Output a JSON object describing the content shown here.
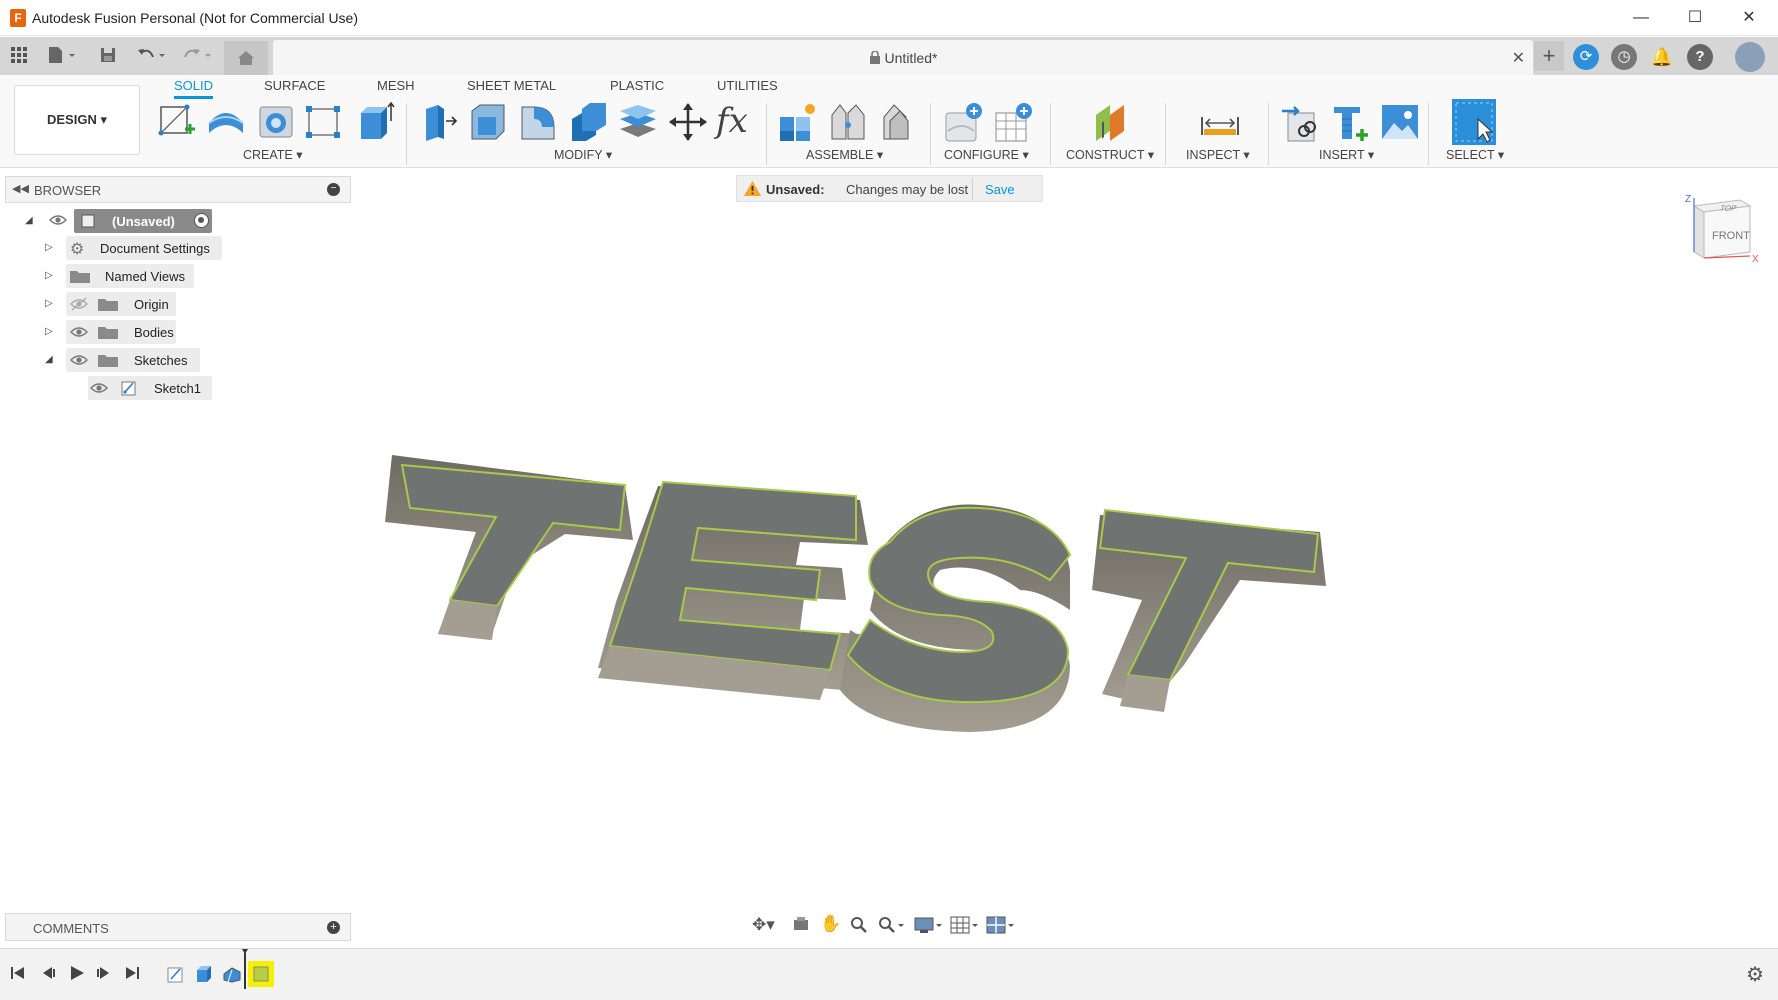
{
  "window": {
    "title": "Autodesk Fusion Personal (Not for Commercial Use)",
    "logo_letter": "F",
    "minimize": "—",
    "maximize": "☐",
    "close": "✕"
  },
  "document": {
    "title": "Untitled*",
    "close": "✕"
  },
  "workspace": {
    "label": "DESIGN ▾"
  },
  "tabs": [
    {
      "label": "SOLID",
      "active": true
    },
    {
      "label": "SURFACE"
    },
    {
      "label": "MESH"
    },
    {
      "label": "SHEET METAL"
    },
    {
      "label": "PLASTIC"
    },
    {
      "label": "UTILITIES"
    }
  ],
  "groups": {
    "create": "CREATE ▾",
    "modify": "MODIFY ▾",
    "assemble": "ASSEMBLE ▾",
    "configure": "CONFIGURE ▾",
    "construct": "CONSTRUCT ▾",
    "inspect": "INSPECT ▾",
    "insert": "INSERT ▾",
    "select": "SELECT ▾"
  },
  "tool_icons": {
    "create": [
      "create-sketch-icon",
      "form-icon",
      "revolve-icon",
      "sketch-pattern-icon",
      "extrude-icon"
    ],
    "modify": [
      "press-pull-icon",
      "shell-icon",
      "fillet-icon",
      "combine-icon",
      "offset-face-icon",
      "move-icon"
    ],
    "modify_fx": "fx",
    "assemble": [
      "new-component-icon",
      "joint-icon",
      "as-built-joint-icon"
    ],
    "configure": [
      "configure-icon",
      "table-icon"
    ],
    "construct": [
      "offset-plane-icon"
    ],
    "inspect": [
      "measure-icon"
    ],
    "insert": [
      "insert-derive-icon",
      "insert-mcmaster-icon",
      "canvas-icon"
    ],
    "select": [
      "select-icon"
    ]
  },
  "browser": {
    "title": "BROWSER",
    "root": "(Unsaved)",
    "items": [
      {
        "label": "Document Settings"
      },
      {
        "label": "Named Views"
      },
      {
        "label": "Origin"
      },
      {
        "label": "Bodies"
      },
      {
        "label": "Sketches"
      },
      {
        "label": "Sketch1"
      }
    ]
  },
  "banner": {
    "title": "Unsaved:",
    "message": "Changes may be lost",
    "action": "Save"
  },
  "viewcube": {
    "top": "TOP",
    "front": "FRONT",
    "axis_z": "Z",
    "axis_x": "X"
  },
  "model": {
    "text": "TEST"
  },
  "comments": {
    "title": "COMMENTS"
  },
  "colors": {
    "accent": "#0696d7",
    "model_face": "#6f7372",
    "model_side": "#9a9488",
    "model_edge": "#a8c94a",
    "warning": "#f5a623"
  }
}
